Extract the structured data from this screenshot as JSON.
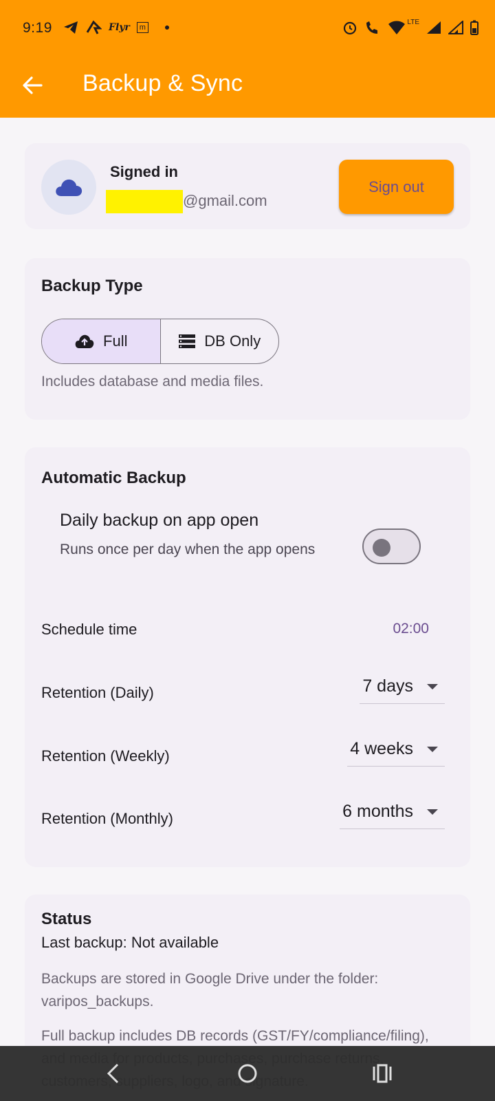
{
  "status_bar": {
    "time": "9:19",
    "flyr_label": "Flyr",
    "m_label": "m",
    "lte_label": "LTE"
  },
  "header": {
    "title": "Backup & Sync",
    "background_color": "#ff9900"
  },
  "account": {
    "signed_in_label": "Signed in",
    "email_domain": "@gmail.com",
    "sign_out_label": "Sign out"
  },
  "backup_type": {
    "title": "Backup Type",
    "options": [
      {
        "label": "Full",
        "icon": "cloud-upload-icon",
        "selected": true
      },
      {
        "label": "DB Only",
        "icon": "storage-icon",
        "selected": false
      }
    ],
    "helper": "Includes database and media files."
  },
  "automatic_backup": {
    "title": "Automatic Backup",
    "daily_title": "Daily backup on app open",
    "daily_subtitle": "Runs once per day when the app opens",
    "daily_enabled": false,
    "schedule_label": "Schedule time",
    "schedule_value": "02:00",
    "retention_daily_label": "Retention (Daily)",
    "retention_daily_value": "7 days",
    "retention_weekly_label": "Retention (Weekly)",
    "retention_weekly_value": "4 weeks",
    "retention_monthly_label": "Retention (Monthly)",
    "retention_monthly_value": "6 months"
  },
  "status": {
    "title": "Status",
    "last_backup": "Last backup: Not available",
    "storage_note": "Backups are stored in Google Drive under the folder: varipos_backups.",
    "full_note": "Full backup includes DB records (GST/FY/compliance/filing), and media for products, purchases, purchase returns, customers, suppliers, logo, and signature."
  },
  "colors": {
    "accent": "#ff9900",
    "primary_text": "#6a4c8f",
    "nav_bar": "#2d2d2d"
  }
}
